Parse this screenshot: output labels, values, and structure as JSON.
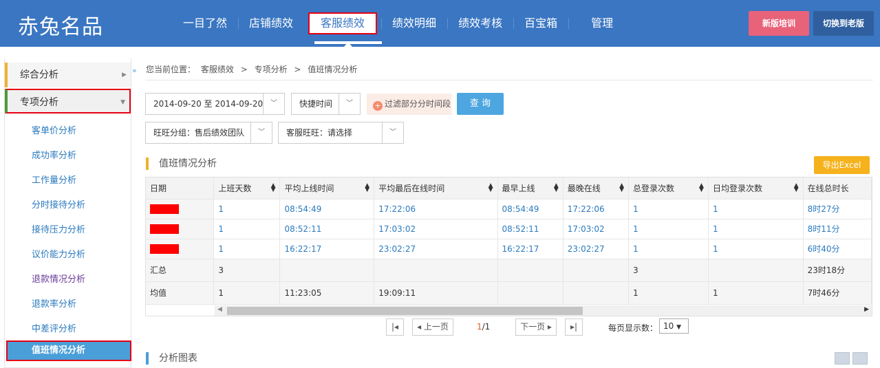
{
  "header": {
    "logo": "赤兔名品",
    "nav": [
      "一目了然",
      "店铺绩效",
      "客服绩效",
      "绩效明细",
      "绩效考核",
      "百宝箱",
      "管理"
    ],
    "new_training": "新版培训",
    "switch_old": "切换到老版"
  },
  "sidebar": {
    "group1": "综合分析",
    "group2": "专项分析",
    "items": [
      "客单价分析",
      "成功率分析",
      "工作量分析",
      "分时接待分析",
      "接待压力分析",
      "议价能力分析",
      "退款情况分析",
      "退款率分析",
      "中差评分析",
      "值班情况分析"
    ],
    "collapse": "»"
  },
  "breadcrumb": {
    "prefix": "您当前位置：",
    "level1": "客服绩效",
    "level2": "专项分析",
    "level3": "值班情况分析",
    "sep": ">"
  },
  "filters": {
    "date_range": "2014-09-20 至 2014-09-20",
    "quick_time": "快捷时间",
    "filter_period": "过滤部分分时间段",
    "query": "查 询",
    "group": "旺旺分组：售后绩效团队",
    "agent": "客服旺旺：请选择"
  },
  "duty_section": {
    "title": "值班情况分析",
    "export": "导出Excel"
  },
  "table": {
    "headers": [
      "日期",
      "上班天数",
      "平均上线时间",
      "平均最后在线时间",
      "最早上线",
      "最晚在线",
      "总登录次数",
      "日均登录次数",
      "在线总时长"
    ],
    "rows": [
      [
        "",
        "1",
        "08:54:49",
        "17:22:06",
        "08:54:49",
        "17:22:06",
        "1",
        "1",
        "8时27分"
      ],
      [
        "",
        "1",
        "08:52:11",
        "17:03:02",
        "08:52:11",
        "17:03:02",
        "1",
        "1",
        "8时11分"
      ],
      [
        "",
        "1",
        "16:22:17",
        "23:02:27",
        "16:22:17",
        "23:02:27",
        "1",
        "1",
        "6时40分"
      ]
    ],
    "summary": [
      [
        "汇总",
        "3",
        "",
        "",
        "",
        "",
        "3",
        "",
        "23时18分"
      ],
      [
        "均值",
        "1",
        "11:23:05",
        "19:09:11",
        "",
        "",
        "1",
        "1",
        "7时46分"
      ]
    ]
  },
  "pagination": {
    "prev": "上一页",
    "next": "下一页",
    "current": "1",
    "total": "/1",
    "per_page_label": "每页显示数：",
    "per_page": "10"
  },
  "chart_section": {
    "title": "分析图表"
  }
}
